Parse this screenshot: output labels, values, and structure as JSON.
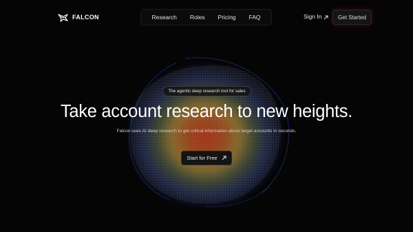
{
  "brand": {
    "name": "FALCON",
    "logo_icon": "falcon-logo-icon"
  },
  "nav": {
    "items": [
      "Research",
      "Roles",
      "Pricing",
      "FAQ"
    ]
  },
  "header": {
    "signin_label": "Sign In",
    "get_started_label": "Get Started"
  },
  "hero": {
    "badge": "The agentic deep research tool for sales",
    "headline": "Take account research to new heights.",
    "subhead": "Falcon uses AI deep research to get critical information about target accounts in seconds.",
    "cta_label": "Start for Free"
  },
  "colors": {
    "background": "#050505",
    "text": "#ffffff",
    "orb_core": "#ff3a1a",
    "orb_mid": "#ffd34a",
    "orb_edge": "#3a66ff"
  }
}
